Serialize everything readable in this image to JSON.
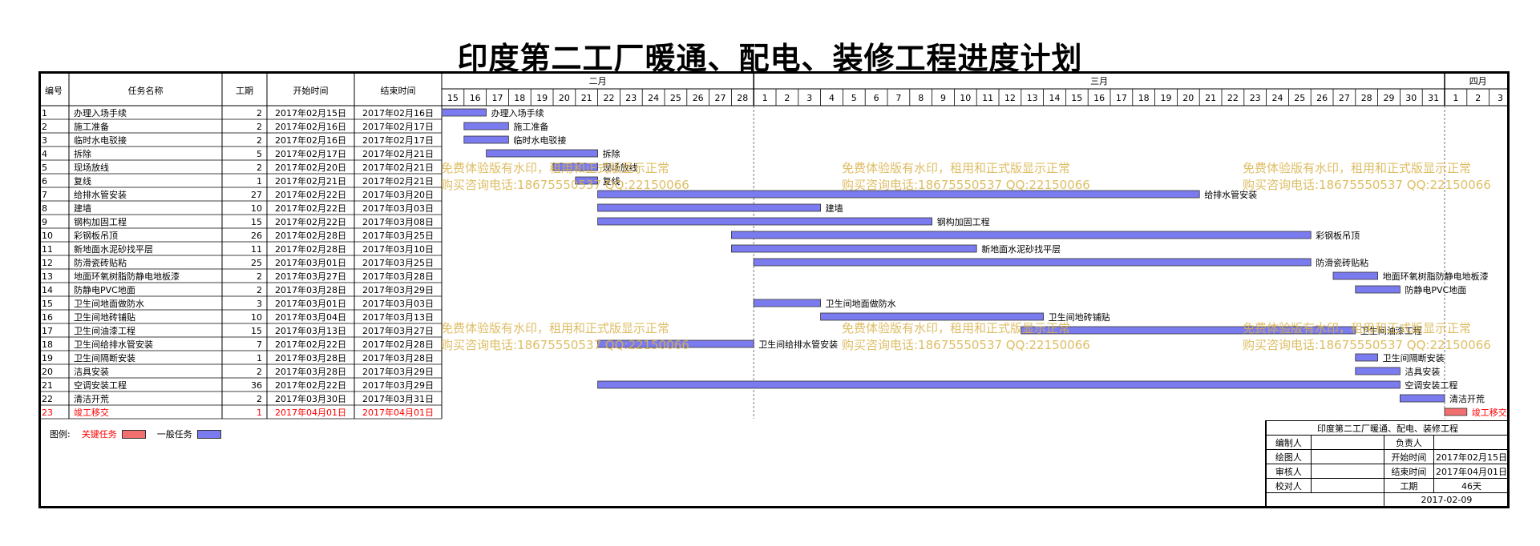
{
  "title": "印度第二工厂暖通、配电、装修工程进度计划",
  "headers": {
    "id": "编号",
    "name": "任务名称",
    "duration": "工期",
    "start": "开始时间",
    "end": "结束时间"
  },
  "colors": {
    "general": "#7b7bf0",
    "critical": "#f26f6f",
    "critical_text": "#ff0000",
    "grid": "#777777"
  },
  "chart_data": {
    "type": "gantt",
    "timeline_months": [
      {
        "label": "二月",
        "days": [
          "15",
          "16",
          "17",
          "18",
          "19",
          "20",
          "21",
          "22",
          "23",
          "24",
          "25",
          "26",
          "27",
          "28"
        ]
      },
      {
        "label": "三月",
        "days": [
          "1",
          "2",
          "3",
          "4",
          "5",
          "6",
          "7",
          "8",
          "9",
          "10",
          "11",
          "12",
          "13",
          "14",
          "15",
          "16",
          "17",
          "18",
          "19",
          "20",
          "21",
          "22",
          "23",
          "24",
          "25",
          "26",
          "27",
          "28",
          "29",
          "30",
          "31"
        ]
      },
      {
        "label": "四月",
        "days": [
          "1",
          "2",
          "3"
        ]
      }
    ],
    "tasks": [
      {
        "id": "1",
        "name": "办理入场手续",
        "duration": "2",
        "start": "2017年02月15日",
        "end": "2017年02月16日",
        "s": 0,
        "e": 2,
        "critical": false
      },
      {
        "id": "2",
        "name": "施工准备",
        "duration": "2",
        "start": "2017年02月16日",
        "end": "2017年02月17日",
        "s": 1,
        "e": 3,
        "critical": false
      },
      {
        "id": "3",
        "name": "临时水电驳接",
        "duration": "2",
        "start": "2017年02月16日",
        "end": "2017年02月17日",
        "s": 1,
        "e": 3,
        "critical": false
      },
      {
        "id": "4",
        "name": "拆除",
        "duration": "5",
        "start": "2017年02月17日",
        "end": "2017年02月21日",
        "s": 2,
        "e": 7,
        "critical": false
      },
      {
        "id": "5",
        "name": "现场放线",
        "duration": "2",
        "start": "2017年02月20日",
        "end": "2017年02月21日",
        "s": 5,
        "e": 7,
        "critical": false
      },
      {
        "id": "6",
        "name": "复线",
        "duration": "1",
        "start": "2017年02月21日",
        "end": "2017年02月21日",
        "s": 6,
        "e": 7,
        "critical": false
      },
      {
        "id": "7",
        "name": "给排水管安装",
        "duration": "27",
        "start": "2017年02月22日",
        "end": "2017年03月20日",
        "s": 7,
        "e": 34,
        "critical": false
      },
      {
        "id": "8",
        "name": "建墙",
        "duration": "10",
        "start": "2017年02月22日",
        "end": "2017年03月03日",
        "s": 7,
        "e": 17,
        "critical": false
      },
      {
        "id": "9",
        "name": "钢构加固工程",
        "duration": "15",
        "start": "2017年02月22日",
        "end": "2017年03月08日",
        "s": 7,
        "e": 22,
        "critical": false
      },
      {
        "id": "10",
        "name": "彩钢板吊顶",
        "duration": "26",
        "start": "2017年02月28日",
        "end": "2017年03月25日",
        "s": 13,
        "e": 39,
        "critical": false
      },
      {
        "id": "11",
        "name": "新地面水泥砂找平层",
        "duration": "11",
        "start": "2017年02月28日",
        "end": "2017年03月10日",
        "s": 13,
        "e": 24,
        "critical": false
      },
      {
        "id": "12",
        "name": "防滑瓷砖贴粘",
        "duration": "25",
        "start": "2017年03月01日",
        "end": "2017年03月25日",
        "s": 14,
        "e": 39,
        "critical": false
      },
      {
        "id": "13",
        "name": "地面环氧树脂防静电地板漆",
        "duration": "2",
        "start": "2017年03月27日",
        "end": "2017年03月28日",
        "s": 40,
        "e": 42,
        "critical": false
      },
      {
        "id": "14",
        "name": "防静电PVC地面",
        "duration": "2",
        "start": "2017年03月28日",
        "end": "2017年03月29日",
        "s": 41,
        "e": 43,
        "critical": false
      },
      {
        "id": "15",
        "name": "卫生间地面做防水",
        "duration": "3",
        "start": "2017年03月01日",
        "end": "2017年03月03日",
        "s": 14,
        "e": 17,
        "critical": false
      },
      {
        "id": "16",
        "name": "卫生间地砖铺贴",
        "duration": "10",
        "start": "2017年03月04日",
        "end": "2017年03月13日",
        "s": 17,
        "e": 27,
        "critical": false
      },
      {
        "id": "17",
        "name": "卫生间油漆工程",
        "duration": "15",
        "start": "2017年03月13日",
        "end": "2017年03月27日",
        "s": 26,
        "e": 41,
        "critical": false
      },
      {
        "id": "18",
        "name": "卫生间给排水管安装",
        "duration": "7",
        "start": "2017年02月22日",
        "end": "2017年02月28日",
        "s": 7,
        "e": 14,
        "critical": false
      },
      {
        "id": "19",
        "name": "卫生间隔断安装",
        "duration": "1",
        "start": "2017年03月28日",
        "end": "2017年03月28日",
        "s": 41,
        "e": 42,
        "critical": false
      },
      {
        "id": "20",
        "name": "洁具安装",
        "duration": "2",
        "start": "2017年03月28日",
        "end": "2017年03月29日",
        "s": 41,
        "e": 43,
        "critical": false
      },
      {
        "id": "21",
        "name": "空调安装工程",
        "duration": "36",
        "start": "2017年02月22日",
        "end": "2017年03月29日",
        "s": 7,
        "e": 43,
        "critical": false
      },
      {
        "id": "22",
        "name": "清洁开荒",
        "duration": "2",
        "start": "2017年03月30日",
        "end": "2017年03月31日",
        "s": 43,
        "e": 45,
        "critical": false
      },
      {
        "id": "23",
        "name": "竣工移交",
        "duration": "1",
        "start": "2017年04月01日",
        "end": "2017年04月01日",
        "s": 45,
        "e": 46,
        "critical": true
      }
    ]
  },
  "watermark": {
    "line1": "免费体验版有水印，租用和正式版显示正常",
    "line2": "购买咨询电话:18675550537 QQ:22150066"
  },
  "legend": {
    "prefix": "图例:",
    "critical_label": "关键任务",
    "general_label": "一般任务"
  },
  "info": {
    "title": "印度第二工厂暖通、配电、装修工程",
    "editor_label": "编制人",
    "editor": "",
    "owner_label": "负责人",
    "owner": "",
    "drawer_label": "绘图人",
    "drawer": "",
    "start_label": "开始时间",
    "start": "2017年02月15日",
    "reviewer_label": "审核人",
    "reviewer": "",
    "end_label": "结束时间",
    "end": "2017年04月01日",
    "checker_label": "校对人",
    "checker": "",
    "duration_label": "工期",
    "duration": "46天",
    "date": "2017-02-09"
  }
}
